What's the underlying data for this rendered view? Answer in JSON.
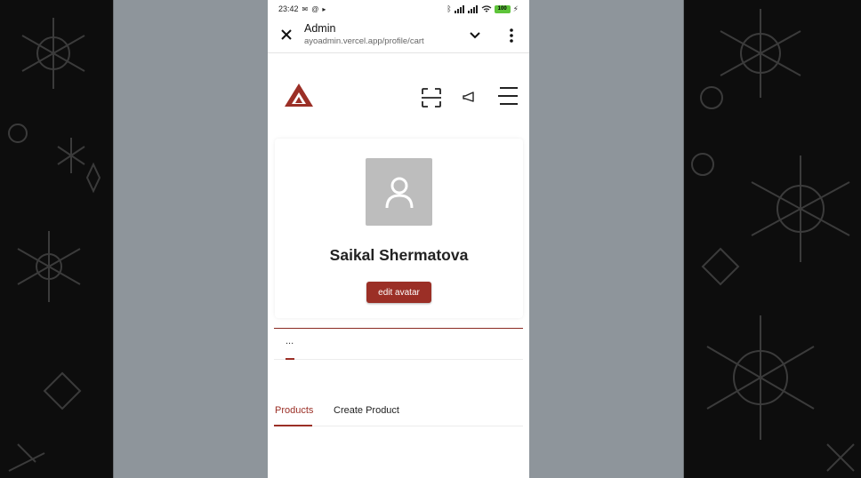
{
  "status_bar": {
    "time": "23:42",
    "battery": "100"
  },
  "browser": {
    "title": "Admin",
    "url": "ayoadmin.vercel.app/profile/cart"
  },
  "site_header": {
    "icons": [
      "logo",
      "scan-icon",
      "announcement-icon",
      "menu-icon"
    ]
  },
  "profile": {
    "name": "Saikal Shermatova",
    "edit_avatar_label": "edit avatar"
  },
  "subtabs": {
    "ellipsis": "..."
  },
  "tabs": [
    {
      "label": "Products",
      "active": true
    },
    {
      "label": "Create Product",
      "active": false
    }
  ],
  "colors": {
    "accent": "#9b2f26",
    "avatar_bg": "#bdbdbd",
    "overlay": "#8e959b",
    "backdrop": "#0d0d0d"
  }
}
